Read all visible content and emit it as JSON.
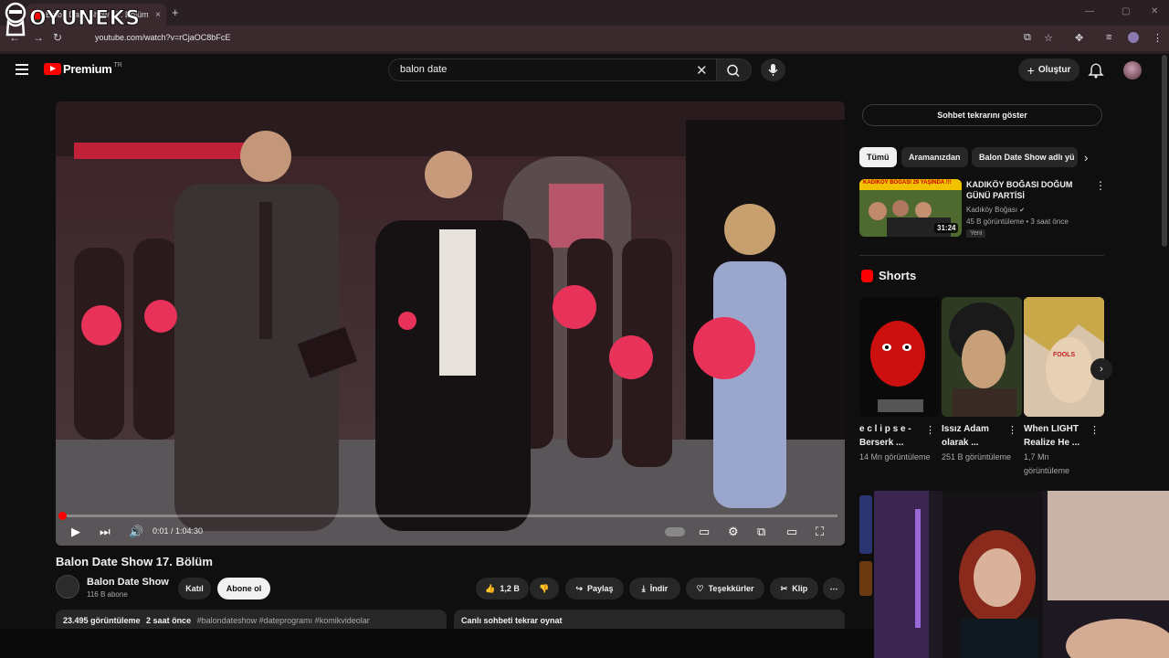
{
  "browser": {
    "tab_title": "Balon Date Show 17. Bölüm - Y",
    "tab_close": "×",
    "new_tab": "+",
    "url": "youtube.com/watch?v=rCjaOC8bFcE",
    "window_controls": [
      "—",
      "▢",
      "✕"
    ]
  },
  "watermark": {
    "text": "OYUNEKS"
  },
  "youtube": {
    "logo_word": "Premium",
    "logo_region": "TR",
    "search_query": "balon date",
    "create_label": "Oluştur"
  },
  "player": {
    "time": "0:01 / 1:04:30",
    "progress_fraction": 0.0003
  },
  "video": {
    "title": "Balon Date Show 17. Bölüm",
    "channel_name": "Balon Date Show",
    "channel_subs": "116 B abone",
    "join_label": "Katıl",
    "subscribe_label": "Abone ol",
    "like_count": "1,2 B",
    "share_label": "Paylaş",
    "download_label": "İndir",
    "thanks_label": "Teşekkürler",
    "clip_label": "Klip",
    "more_label": "⋯",
    "views": "23.495 görüntüleme",
    "age": "2 saat önce",
    "hashtags": "#balondateshow #dateprogramı #komikvideolar",
    "chat_replay_title": "Canlı sohbeti tekrar oynat"
  },
  "sidebar": {
    "show_chat": "Sohbet tekrarını göster",
    "chips": [
      "Tümü",
      "Aramanızdan",
      "Balon Date Show adlı yü"
    ],
    "recommended": {
      "title": "KADIKÖY BOĞASI DOĞUM GÜNÜ PARTİSİ",
      "thumb_banner": "KADIKÖY BOĞASI 29 YAŞINDA !!!",
      "channel": "Kadıköy Boğası",
      "meta": "45 B görüntüleme • 3 saat önce",
      "badge": "Yeni",
      "duration": "31:24"
    },
    "shorts_label": "Shorts",
    "shorts": [
      {
        "title": "e c l i p s e - Berserk ...",
        "views": "14 Mn görüntüleme"
      },
      {
        "title": "Issız Adam olarak ...",
        "views": "251 B görüntüleme"
      },
      {
        "title": "When LIGHT Realize He ...",
        "views": "1,7 Mn görüntüleme"
      }
    ],
    "short3_overlay": "FOOLS"
  },
  "colors": {
    "accent": "#ff0000",
    "background": "#0f0f0f",
    "chrome": "#2a1f22",
    "balloon": "#e8325a"
  }
}
